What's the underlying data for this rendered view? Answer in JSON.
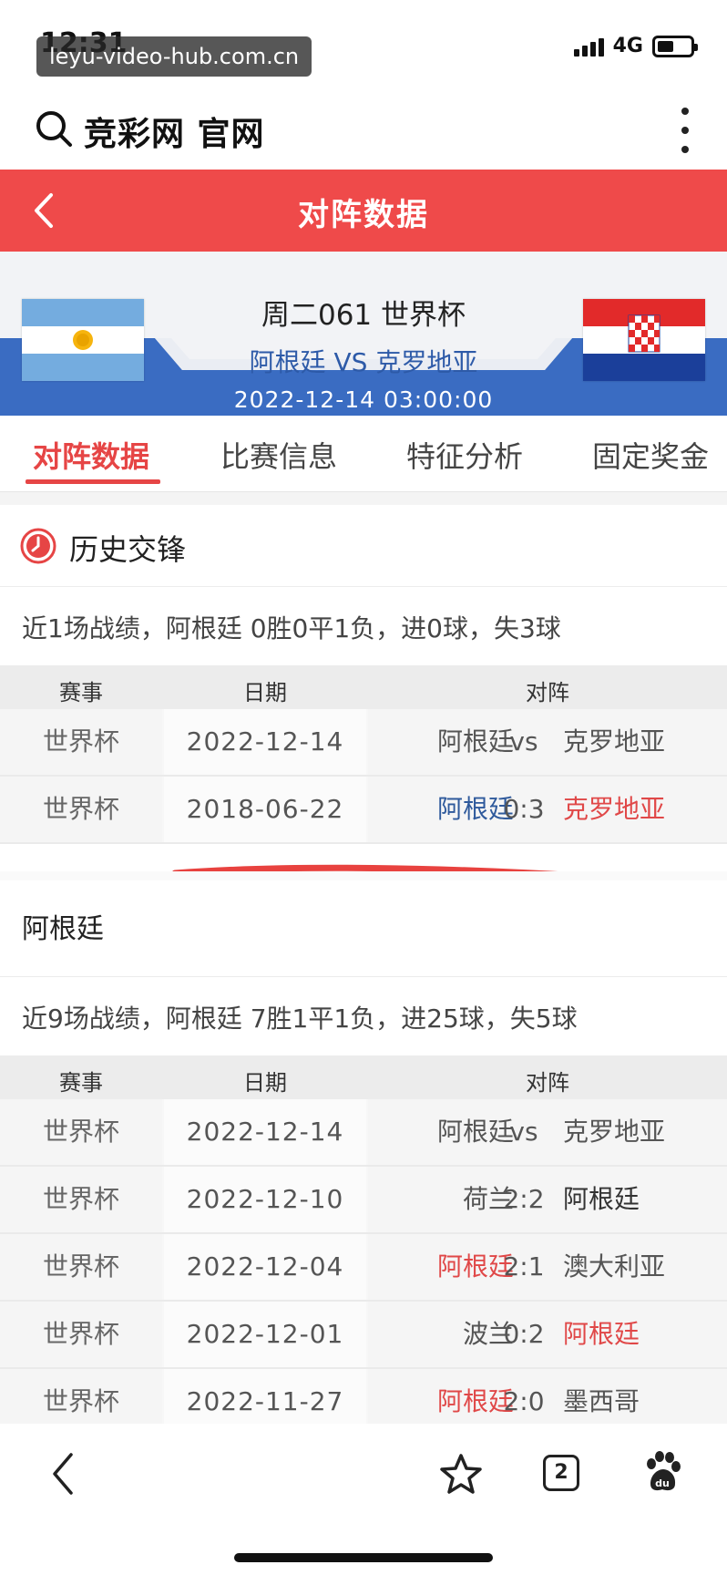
{
  "status_bar": {
    "time": "12:31",
    "url_overlay": "leyu-video-hub.com.cn",
    "network": "4G",
    "battery_level": 0.5
  },
  "search_bar": {
    "site_title": "竞彩网 官网"
  },
  "header": {
    "title": "对阵数据"
  },
  "match": {
    "round": "周二061 世界杯",
    "teams": "阿根廷 VS 克罗地亚",
    "datetime": "2022-12-14 03:00:00"
  },
  "tabs": [
    {
      "label": "对阵数据",
      "active": true
    },
    {
      "label": "比赛信息",
      "active": false
    },
    {
      "label": "特征分析",
      "active": false
    },
    {
      "label": "固定奖金",
      "active": false
    }
  ],
  "history": {
    "title": "历史交锋",
    "summary": "近1场战绩，阿根廷 0胜0平1负，进0球，失3球",
    "columns": [
      "赛事",
      "日期",
      "对阵"
    ],
    "rows": [
      {
        "comp": "世界杯",
        "date": "2022-12-14",
        "home": "阿根廷",
        "mid": "vs",
        "away": "克罗地亚"
      },
      {
        "comp": "世界杯",
        "date": "2018-06-22",
        "home": "阿根廷",
        "mid": "0:3",
        "away": "克罗地亚"
      }
    ]
  },
  "team_section": {
    "title": "阿根廷",
    "summary": "近9场战绩，阿根廷 7胜1平1负，进25球，失5球",
    "columns": [
      "赛事",
      "日期",
      "对阵"
    ],
    "rows": [
      {
        "comp": "世界杯",
        "date": "2022-12-14",
        "home": "阿根廷",
        "mid": "vs",
        "away": "克罗地亚"
      },
      {
        "comp": "世界杯",
        "date": "2022-12-10",
        "home": "荷兰",
        "mid": "2:2",
        "away": "阿根廷"
      },
      {
        "comp": "世界杯",
        "date": "2022-12-04",
        "home": "阿根廷",
        "mid": "2:1",
        "away": "澳大利亚"
      },
      {
        "comp": "世界杯",
        "date": "2022-12-01",
        "home": "波兰",
        "mid": "0:2",
        "away": "阿根廷"
      },
      {
        "comp": "世界杯",
        "date": "2022-11-27",
        "home": "阿根廷",
        "mid": "2:0",
        "away": "墨西哥"
      }
    ]
  },
  "bottom_nav": {
    "tab_count": "2"
  },
  "colors": {
    "accent_red": "#ef4a4a",
    "win_red": "#e04848",
    "team_blue": "#2f5a9c",
    "banner_blue": "#3a6cc2"
  }
}
